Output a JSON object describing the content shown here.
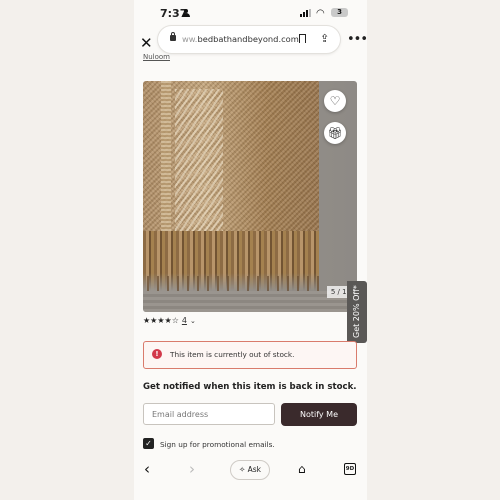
{
  "status_bar": {
    "time": "7:37",
    "battery": "3"
  },
  "browser": {
    "url": "bedbathandbeyond.com",
    "url_prefix": "ww.",
    "icons": {
      "close": "close-icon",
      "lock": "lock-icon",
      "bookmark": "bookmark-icon",
      "share": "share-icon",
      "more": "more-icon"
    }
  },
  "product": {
    "brand_link": "Nuloom",
    "image_counter": "5 / 16",
    "rating": {
      "stars_display": "★★★★☆",
      "stars": 4,
      "count": "4"
    },
    "promo_tab": "Get 20% Off*"
  },
  "stock": {
    "alert_text": "This item is currently out of stock.",
    "notify_heading": "Get notified when this item is back in stock.",
    "email_placeholder": "Email address",
    "notify_button": "Notify Me",
    "checkbox_label": "Sign up for promotional emails.",
    "checkbox_checked": true
  },
  "toolbar": {
    "ask_label": "Ask",
    "tabs_count": "9D"
  },
  "colors": {
    "alert_border": "#d97b6c",
    "alert_icon": "#d2394b",
    "notify_button": "#3a2a2c"
  }
}
